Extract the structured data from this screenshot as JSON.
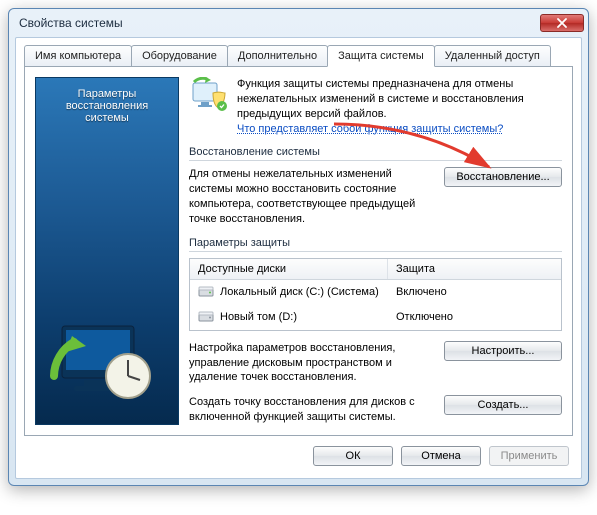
{
  "window": {
    "title": "Свойства системы"
  },
  "tabs": {
    "t0": "Имя компьютера",
    "t1": "Оборудование",
    "t2": "Дополнительно",
    "t3": "Защита системы",
    "t4": "Удаленный доступ"
  },
  "sidepanel": {
    "line1": "Параметры",
    "line2": "восстановления",
    "line3": "системы"
  },
  "desc": {
    "text": "Функция защиты системы предназначена для отмены нежелательных изменений в системе и восстановления предыдущих версий файлов.",
    "link": "Что представляет собой функция защиты системы?"
  },
  "restore": {
    "group_title": "Восстановление системы",
    "text": "Для отмены нежелательных изменений системы можно восстановить состояние компьютера, соответствующее предыдущей точке восстановления.",
    "button": "Восстановление..."
  },
  "protection": {
    "group_title": "Параметры защиты",
    "col_drive": "Доступные диски",
    "col_prot": "Защита",
    "drives": [
      {
        "name": "Локальный диск (С:) (Система)",
        "status": "Включено"
      },
      {
        "name": "Новый том (D:)",
        "status": "Отключено"
      }
    ],
    "configure_text": "Настройка параметров восстановления, управление дисковым пространством и удаление точек восстановления.",
    "configure_btn": "Настроить...",
    "create_text": "Создать точку восстановления для дисков с включенной функцией защиты системы.",
    "create_btn": "Создать..."
  },
  "footer": {
    "ok": "ОК",
    "cancel": "Отмена",
    "apply": "Применить"
  }
}
